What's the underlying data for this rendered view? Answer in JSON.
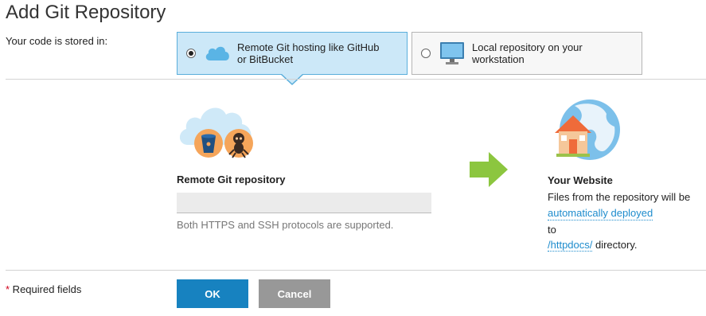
{
  "page": {
    "title": "Add Git Repository"
  },
  "storage": {
    "label": "Your code is stored in:",
    "options": [
      {
        "label_line1": "Remote Git hosting like GitHub",
        "label_line2": "or BitBucket",
        "selected": true,
        "icon": "cloud-icon"
      },
      {
        "label_line1": "Local repository on your",
        "label_line2": "workstation",
        "selected": false,
        "icon": "monitor-icon"
      }
    ]
  },
  "remote": {
    "label": "Remote Git repository",
    "input_value": "",
    "hint": "Both HTTPS and SSH protocols are supported.",
    "icons": [
      "cloud-illustration-icon",
      "bitbucket-icon",
      "github-octocat-icon"
    ]
  },
  "arrow": {
    "icon": "arrow-right-icon",
    "color": "#8cc63f"
  },
  "website": {
    "title": "Your Website",
    "line1": "Files from the repository will be",
    "link1": "automatically deployed",
    "line3": "to",
    "link2": "/httpdocs/",
    "line4_suffix": " directory.",
    "icon": "house-globe-icon"
  },
  "form": {
    "required_star": "*",
    "required_label": " Required fields",
    "ok_label": "OK",
    "cancel_label": "Cancel"
  },
  "colors": {
    "selected_bg": "#cce8f8",
    "selected_border": "#5aaedb",
    "primary_button": "#1782c0",
    "secondary_button": "#989898",
    "link": "#1e8ccd"
  }
}
